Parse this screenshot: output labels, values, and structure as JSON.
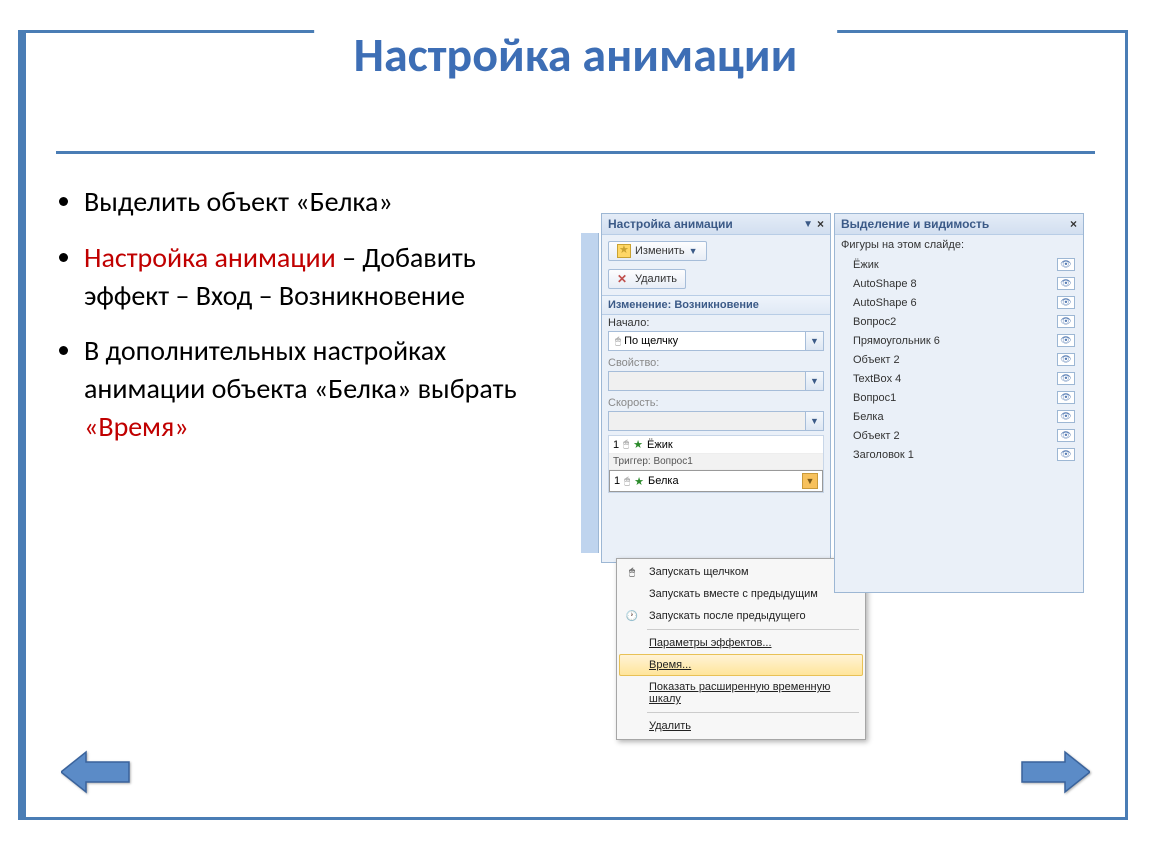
{
  "title": "Настройка анимации",
  "bullets": {
    "b1": "Выделить объект «Белка»",
    "b2_red": "Настройка анимации",
    "b2_rest": " – Добавить эффект – Вход – Возникновение",
    "b3_a": "В дополнительных настройках анимации объекта «Белка» выбрать ",
    "b3_red": "«Время»"
  },
  "anim_panel": {
    "title": "Настройка анимации",
    "change_btn": "Изменить",
    "delete_btn": "Удалить",
    "section": "Изменение: Возникновение",
    "start_label": "Начало:",
    "start_value": "По щелчку",
    "property_label": "Свойство:",
    "speed_label": "Скорость:",
    "list": {
      "row1_num": "1",
      "row1_name": "Ёжик",
      "trigger": "Триггер: Вопрос1",
      "row2_num": "1",
      "row2_name": "Белка"
    }
  },
  "context_menu": {
    "i1": "Запускать щелчком",
    "i2": "Запускать вместе с предыдущим",
    "i3": "Запускать после предыдущего",
    "i4": "Параметры эффектов...",
    "i5": "Время...",
    "i6": "Показать расширенную временную шкалу",
    "i7": "Удалить"
  },
  "sel_panel": {
    "title": "Выделение и видимость",
    "subtitle": "Фигуры на этом слайде:",
    "items": [
      "Ёжик",
      "AutoShape 8",
      "AutoShape 6",
      "Вопрос2",
      "Прямоугольник 6",
      "Объект 2",
      "TextBox 4",
      "Вопрос1",
      "Белка",
      "Объект 2",
      "Заголовок 1"
    ]
  }
}
